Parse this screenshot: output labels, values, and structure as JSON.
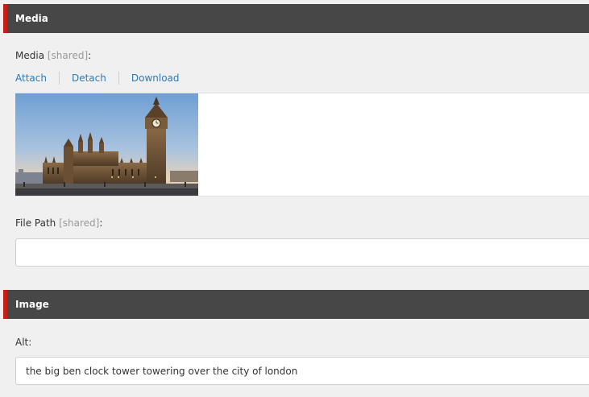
{
  "media_section": {
    "title": "Media",
    "media_field": {
      "label": "Media",
      "shared": "[shared]",
      "colon": ":"
    },
    "actions": {
      "attach": "Attach",
      "detach": "Detach",
      "download": "Download"
    },
    "file_path_field": {
      "label": "File Path",
      "shared": "[shared]",
      "colon": ":",
      "value": ""
    }
  },
  "image_section": {
    "title": "Image",
    "alt_field": {
      "label": "Alt:",
      "value": "the big ben clock tower towering over the city of london"
    }
  },
  "colors": {
    "header_bg": "#474747",
    "accent": "#c81e14",
    "link": "#2a7ab8"
  }
}
